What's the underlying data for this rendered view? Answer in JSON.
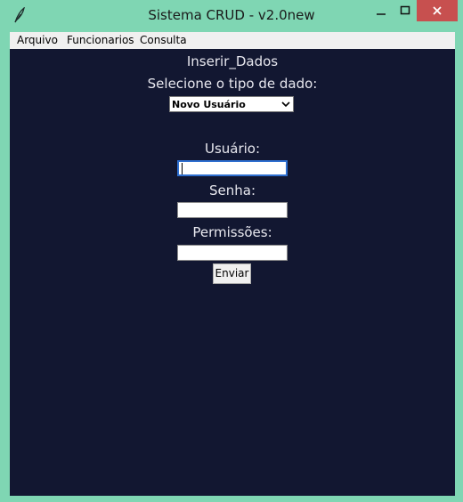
{
  "window": {
    "title": "Sistema CRUD - v2.0new",
    "icon": "feather-icon",
    "controls": [
      "minimize-icon",
      "maximize-icon",
      "close-icon"
    ],
    "accent_color": "#7fd6b3",
    "close_color": "#c7504f"
  },
  "menubar": {
    "items": [
      {
        "label": "Arquivo"
      },
      {
        "label": "Funcionarios"
      },
      {
        "label": "Consulta"
      }
    ]
  },
  "main": {
    "background": "#121731",
    "heading": "Inserir_Dados",
    "type_prompt": "Selecione o tipo de dado:",
    "type_select": {
      "selected": "Novo Usuário"
    },
    "fields": [
      {
        "label": "Usuário:",
        "value": ""
      },
      {
        "label": "Senha:",
        "value": ""
      },
      {
        "label": "Permissões:",
        "value": ""
      }
    ],
    "submit_label": "Enviar"
  }
}
